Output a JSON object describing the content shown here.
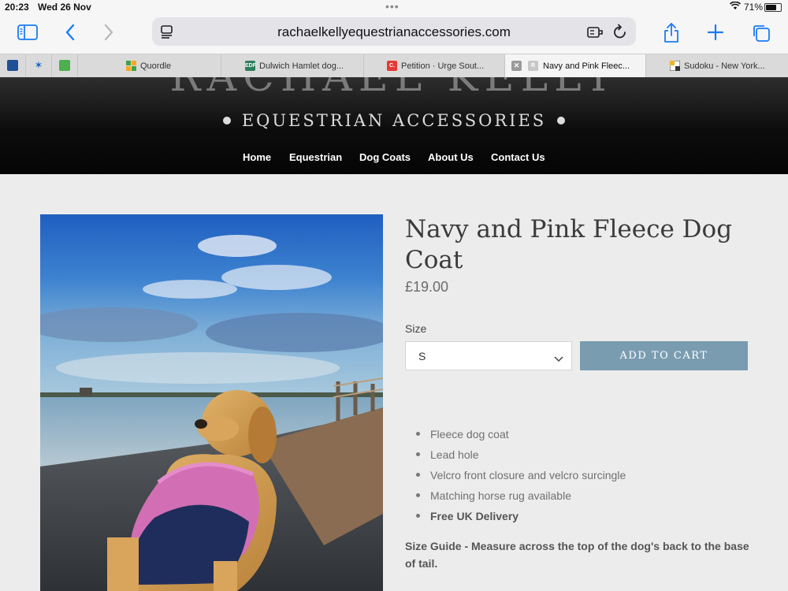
{
  "status_bar": {
    "time": "20:23",
    "date": "Wed 26 Nov",
    "battery": "71%",
    "battery_level": 0.71
  },
  "toolbar": {
    "url": "rachaelkellyequestrianaccessories.com"
  },
  "tabs": [
    {
      "label": "Quordle",
      "favicon_color": "#43a047"
    },
    {
      "label": "Dulwich Hamlet dog...",
      "favicon_text": "EDF",
      "favicon_color": "#2e7d5b"
    },
    {
      "label": "Petition · Urge Sout...",
      "favicon_text": "C.",
      "favicon_color": "#e53935"
    },
    {
      "label": "Navy and Pink Fleec...",
      "favicon_text": "R",
      "favicon_color": "#c8c8c8"
    },
    {
      "label": "Sudoku - New York...",
      "favicon_color": "#f0b429"
    }
  ],
  "header": {
    "logo_top": "RACHAEL KELLY",
    "logo_sub": "EQUESTRIAN ACCESSORIES",
    "nav": [
      "Home",
      "Equestrian",
      "Dog Coats",
      "About Us",
      "Contact Us"
    ]
  },
  "product": {
    "title": "Navy and Pink Fleece Dog Coat",
    "price": "£19.00",
    "size_label": "Size",
    "size_value": "S",
    "add_to_cart": "ADD TO CART",
    "features": [
      "Fleece dog coat",
      "Lead hole",
      "Velcro front closure and velcro surcingle",
      "Matching horse rug available",
      "Free UK Delivery"
    ],
    "size_guide": "Size Guide - Measure across the top of the dog's back to the base of tail."
  },
  "colors": {
    "safari_blue": "#1a7cf5",
    "cart_button": "#7a9cb1",
    "header_black": "#0c0c0c"
  }
}
